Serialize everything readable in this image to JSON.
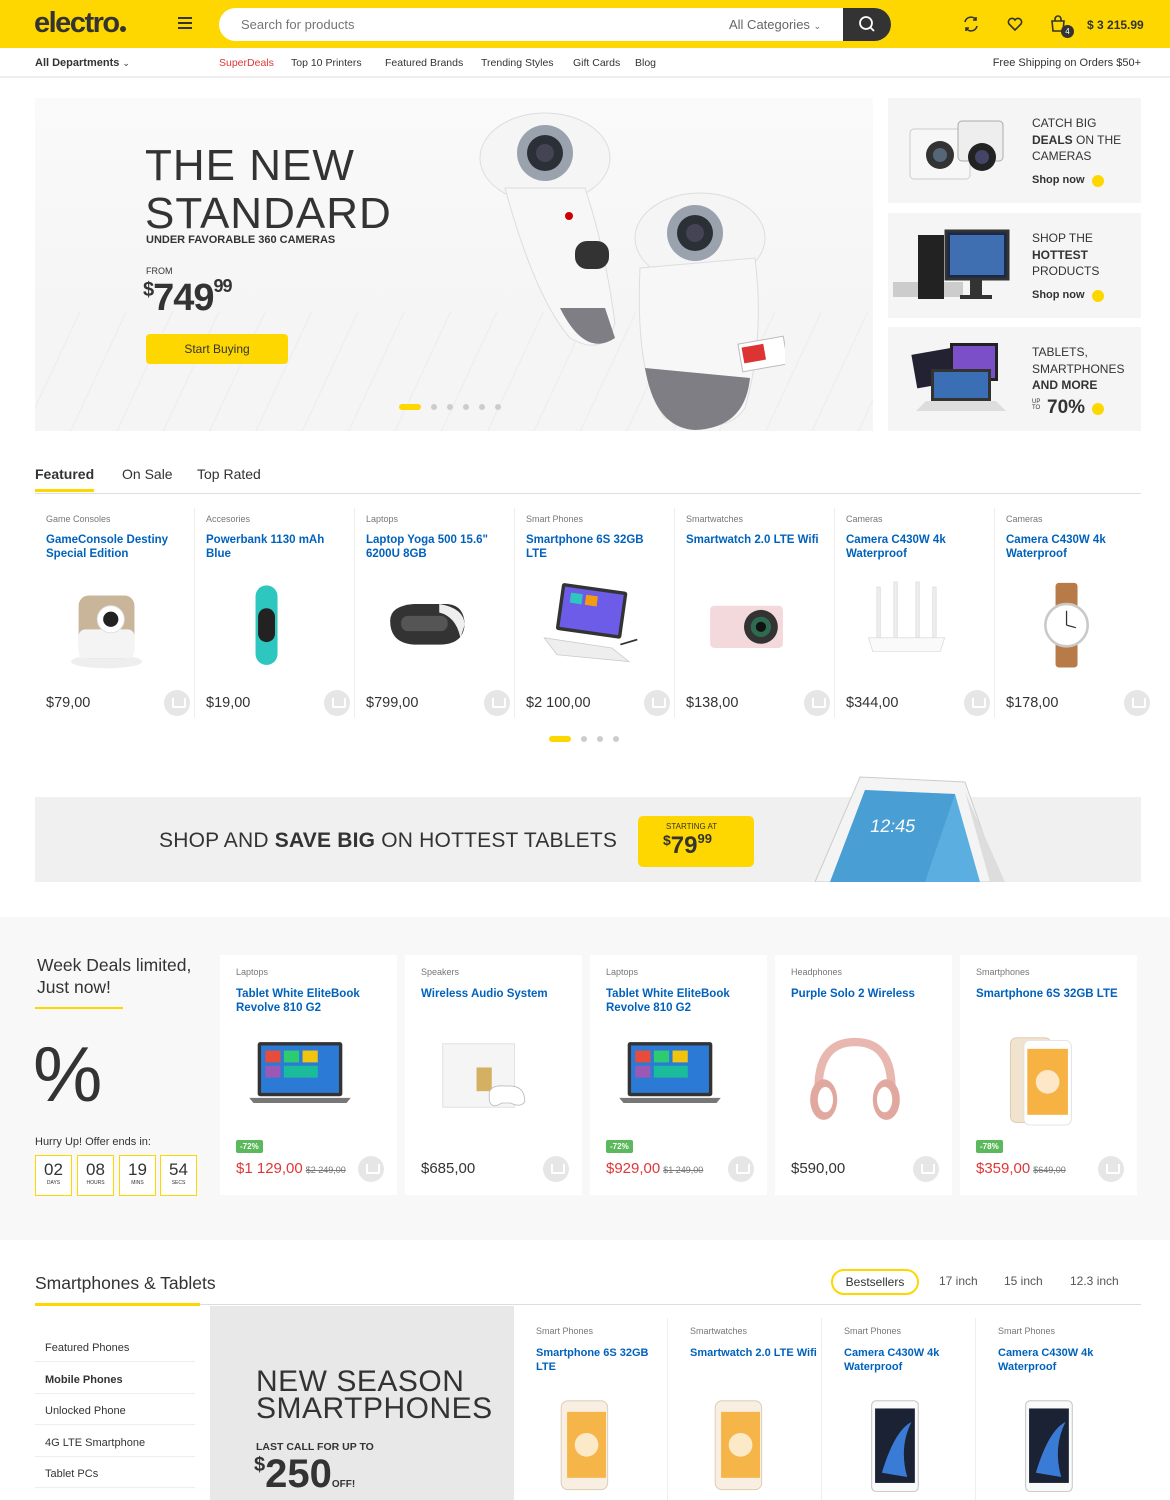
{
  "header": {
    "logo": "electro",
    "search_placeholder": "Search for products",
    "search_category": "All Categories",
    "cart_count": "4",
    "cart_total": "$ 3 215.99",
    "accent": "#fed700"
  },
  "nav": {
    "departments": "All Departments",
    "links": [
      "SuperDeals",
      "Top 10 Printers",
      "Featured Brands",
      "Trending Styles",
      "Gift Cards",
      "Blog"
    ],
    "free_shipping": "Free Shipping on Orders $50+"
  },
  "hero": {
    "title_line1": "THE NEW",
    "title_line2": "STANDARD",
    "subtitle": "UNDER FAVORABLE 360 CAMERAS",
    "from": "FROM",
    "price_cur": "$",
    "price_main": "749",
    "price_cents": "99",
    "button": "Start Buying"
  },
  "side_banners": [
    {
      "line1": "CATCH BIG",
      "line2": "DEALS",
      "line2b": " ON THE",
      "line3": "CAMERAS",
      "cta": "Shop now"
    },
    {
      "line1": "SHOP THE",
      "line2": "HOTTEST",
      "line3": "PRODUCTS",
      "cta": "Shop now"
    },
    {
      "line1": "TABLETS,",
      "line2": "SMARTPHONES",
      "line3": "AND MORE",
      "up": "UP TO",
      "pct": "70%"
    }
  ],
  "tabs": [
    "Featured",
    "On Sale",
    "Top Rated"
  ],
  "featured": [
    {
      "cat": "Game Consoles",
      "name": "GameConsole Destiny Special Edition",
      "price": "$79,00",
      "icon": "camera-icon"
    },
    {
      "cat": "Accesories",
      "name": "Powerbank 1130 mAh Blue",
      "price": "$19,00",
      "icon": "band-icon"
    },
    {
      "cat": "Laptops",
      "name": "Laptop Yoga 500 15.6\" 6200U 8GB",
      "price": "$799,00",
      "icon": "vr-icon"
    },
    {
      "cat": "Smart Phones",
      "name": "Smartphone 6S 32GB LTE",
      "price": "$2 100,00",
      "icon": "tablet-icon"
    },
    {
      "cat": "Smartwatches",
      "name": "Smartwatch 2.0 LTE Wifi",
      "price": "$138,00",
      "icon": "actioncam-icon"
    },
    {
      "cat": "Cameras",
      "name": "Camera C430W 4k Waterproof",
      "price": "$344,00",
      "icon": "router-icon"
    },
    {
      "cat": "Cameras",
      "name": "Camera C430W 4k Waterproof",
      "price": "$178,00",
      "icon": "watch-icon"
    }
  ],
  "tablet_banner": {
    "pre": "SHOP AND ",
    "bold": "SAVE BIG",
    "post": " ON HOTTEST TABLETS",
    "starting": "STARTING AT",
    "cur": "$",
    "price": "79",
    "cents": "99"
  },
  "week_deals": {
    "title": "Week Deals limited, Just now!",
    "pct": "%",
    "hurry": "Hurry Up! Offer ends in:",
    "countdown": [
      {
        "n": "02",
        "l": "DAYS"
      },
      {
        "n": "08",
        "l": "HOURS"
      },
      {
        "n": "19",
        "l": "MINS"
      },
      {
        "n": "54",
        "l": "SECS"
      }
    ],
    "items": [
      {
        "cat": "Laptops",
        "name": "Tablet White EliteBook Revolve 810 G2",
        "badge": "-72%",
        "price": "$1 129,00",
        "old": "$2 249,00",
        "icon": "laptop-icon"
      },
      {
        "cat": "Speakers",
        "name": "Wireless Audio System",
        "badge": "",
        "price": "$685,00",
        "old": "",
        "icon": "console-icon"
      },
      {
        "cat": "Laptops",
        "name": "Tablet White EliteBook Revolve 810 G2",
        "badge": "-72%",
        "price": "$929,00",
        "old": "$1 249,00",
        "icon": "laptop-icon"
      },
      {
        "cat": "Headphones",
        "name": "Purple Solo 2 Wireless",
        "badge": "",
        "price": "$590,00",
        "old": "",
        "icon": "headphones-icon"
      },
      {
        "cat": "Smartphones",
        "name": "Smartphone 6S 32GB LTE",
        "badge": "-78%",
        "price": "$359,00",
        "old": "$649,00",
        "icon": "phone-icon"
      }
    ]
  },
  "smartphones": {
    "title": "Smartphones & Tablets",
    "tabs": [
      "Bestsellers",
      "17 inch",
      "15 inch",
      "12.3 inch"
    ],
    "categories": [
      "Featured Phones",
      "Mobile Phones",
      "Unlocked Phone",
      "4G LTE Smartphone",
      "Tablet PCs"
    ],
    "promo": {
      "line1": "NEW SEASON",
      "line2": "SMARTPHONES",
      "sub": "LAST CALL FOR UP TO",
      "cur": "$",
      "amount": "250",
      "off": "OFF!"
    },
    "items": [
      {
        "cat": "Smart Phones",
        "name": "Smartphone 6S 32GB LTE"
      },
      {
        "cat": "Smartwatches",
        "name": "Smartwatch 2.0 LTE Wifi"
      },
      {
        "cat": "Smart Phones",
        "name": "Camera C430W 4k Waterproof"
      },
      {
        "cat": "Smart Phones",
        "name": "Camera C430W 4k Waterproof"
      }
    ]
  }
}
